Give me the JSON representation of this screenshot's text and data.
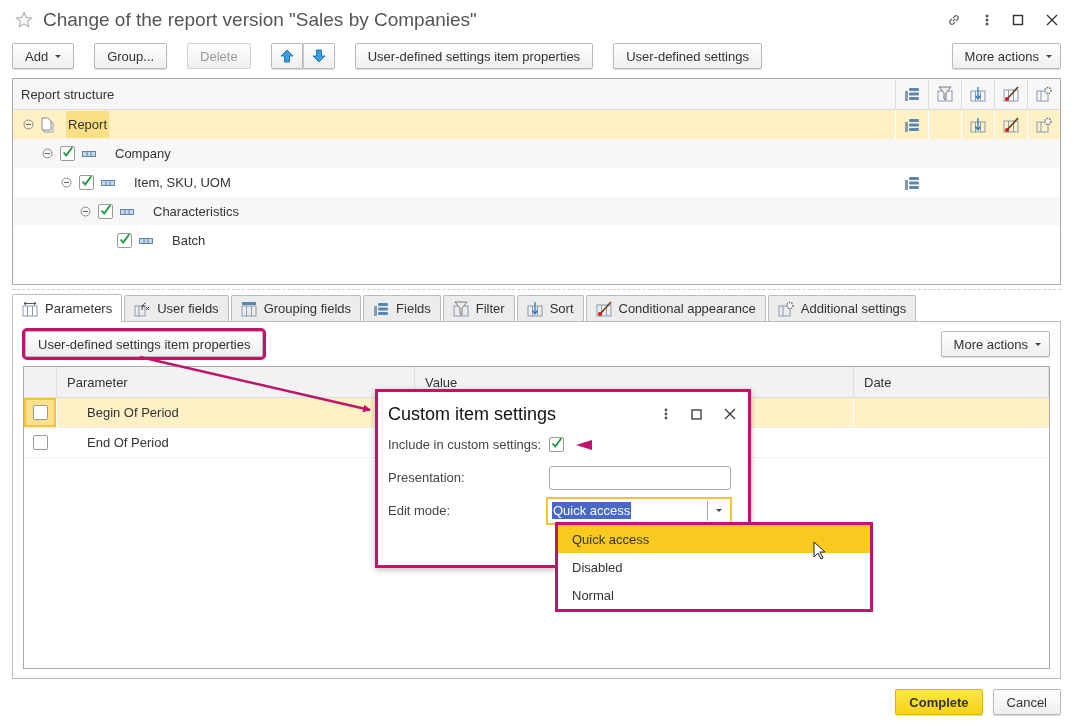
{
  "window": {
    "title": "Change of the report version \"Sales by Companies\""
  },
  "toolbar": {
    "buttons": [
      {
        "label": "Add",
        "kind": "dropdown",
        "disabled": false
      },
      {
        "label": "Group...",
        "kind": "plain",
        "disabled": false
      },
      {
        "label": "Delete",
        "kind": "plain",
        "disabled": true
      },
      {
        "kind": "arrow-up",
        "disabled": false
      },
      {
        "kind": "arrow-down",
        "disabled": false
      },
      {
        "label": "User-defined settings item properties",
        "kind": "plain",
        "disabled": false
      },
      {
        "label": "User-defined settings",
        "kind": "plain",
        "disabled": false
      }
    ],
    "more": {
      "label": "More actions"
    }
  },
  "tree": {
    "header": "Report structure",
    "columns": [
      {
        "kind": "fields"
      },
      {
        "kind": "filter"
      },
      {
        "kind": "sort"
      },
      {
        "kind": "appearance"
      },
      {
        "kind": "additional"
      }
    ],
    "nodes": [
      {
        "label": "Report",
        "kind": "root",
        "selected": true,
        "expanded": true,
        "settings": [
          true,
          false,
          true,
          true,
          true
        ],
        "children": [
          {
            "label": "Company",
            "kind": "group",
            "checked": true,
            "selected": false,
            "expanded": true,
            "settings": [
              false,
              false,
              false,
              false,
              false
            ],
            "children": [
              {
                "label": "Item, SKU, UOM",
                "kind": "group",
                "checked": true,
                "selected": false,
                "expanded": true,
                "settings": [
                  true,
                  false,
                  false,
                  false,
                  false
                ],
                "children": [
                  {
                    "label": "Characteristics",
                    "kind": "group",
                    "checked": true,
                    "selected": false,
                    "expanded": true,
                    "settings": [
                      false,
                      false,
                      false,
                      false,
                      false
                    ],
                    "children": [
                      {
                        "label": "Batch",
                        "kind": "group",
                        "checked": true,
                        "selected": false,
                        "settings": [
                          false,
                          false,
                          false,
                          false,
                          false
                        ]
                      }
                    ]
                  }
                ]
              }
            ]
          }
        ]
      }
    ]
  },
  "tabs": [
    {
      "label": "Parameters",
      "kind": "parameters",
      "selected": true
    },
    {
      "label": "User fields",
      "kind": "user-fields",
      "selected": false
    },
    {
      "label": "Grouping fields",
      "kind": "grouping",
      "selected": false
    },
    {
      "label": "Fields",
      "kind": "fields",
      "selected": false
    },
    {
      "label": "Filter",
      "kind": "filter",
      "selected": false
    },
    {
      "label": "Sort",
      "kind": "sort",
      "selected": false
    },
    {
      "label": "Conditional appearance",
      "kind": "appearance",
      "selected": false
    },
    {
      "label": "Additional settings",
      "kind": "additional",
      "selected": false
    }
  ],
  "parameters": {
    "button": {
      "label": "User-defined settings item properties",
      "annotated": true
    },
    "more": {
      "label": "More actions"
    },
    "columns": [
      "Parameter",
      "Value",
      "Date"
    ],
    "rows": [
      {
        "parameter": "Begin Of Period",
        "checked": false,
        "selected": true
      },
      {
        "parameter": "End Of Period",
        "checked": false,
        "selected": false
      }
    ]
  },
  "dialog": {
    "title": "Custom item settings",
    "include_label": "Include in custom settings:",
    "include_checked": true,
    "presentation_label": "Presentation:",
    "edit_mode_label": "Edit mode:",
    "edit_mode_value": "Quick access",
    "options": [
      {
        "label": "Quick access",
        "selected": true
      },
      {
        "label": "Disabled",
        "selected": false
      },
      {
        "label": "Normal",
        "selected": false
      }
    ]
  },
  "footer": [
    {
      "label": "Complete",
      "default": true
    },
    {
      "label": "Cancel",
      "default": false
    }
  ]
}
